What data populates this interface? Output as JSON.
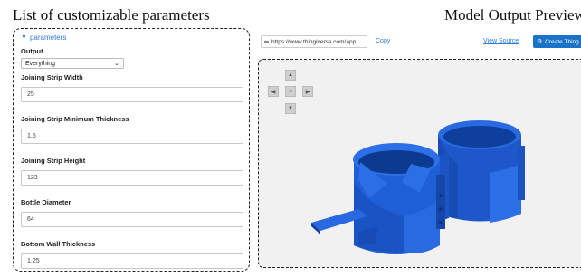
{
  "captions": {
    "left": "List of customizable parameters",
    "right": "Model Output Preview"
  },
  "params": {
    "toggle_label": "parameters",
    "output_label": "Output",
    "output_value": "Everything",
    "fields": [
      {
        "label": "Joining Strip Width",
        "value": "25"
      },
      {
        "label": "Joining Strip Minimum Thickness",
        "value": "1.5"
      },
      {
        "label": "Joining Strip Height",
        "value": "123"
      },
      {
        "label": "Bottle Diameter",
        "value": "64"
      },
      {
        "label": "Bottom Wall Thickness",
        "value": "1.25"
      }
    ]
  },
  "toolbar": {
    "url": "https://www.thingiverse.com/app",
    "copy_label": "Copy",
    "view_source_label": "View Source",
    "create_label": "Create Thing"
  },
  "colors": {
    "link": "#2f7bd6",
    "button": "#1a73c9",
    "model": "#1f5fd6"
  },
  "icons": [
    "chevron-down-icon",
    "link-icon",
    "gear-icon",
    "arrow-up-icon",
    "arrow-left-icon",
    "home-icon",
    "arrow-right-icon",
    "arrow-down-icon"
  ]
}
